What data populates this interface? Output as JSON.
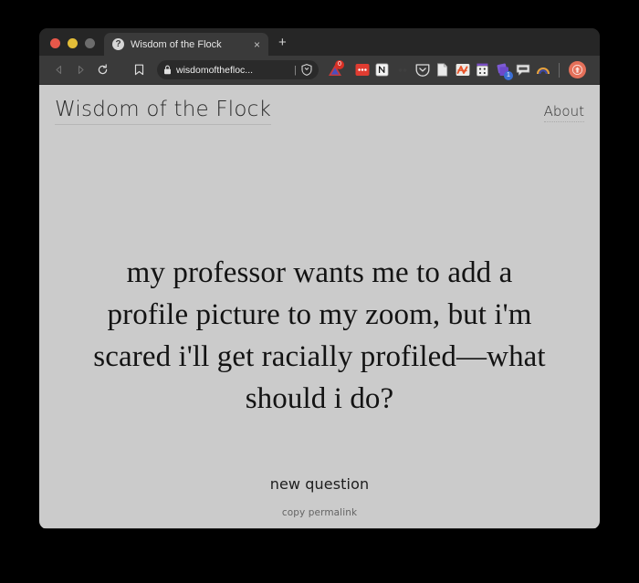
{
  "browser": {
    "traffic_lights": [
      "close",
      "minimize",
      "zoom"
    ],
    "tab": {
      "favicon": "question-mark-favicon",
      "title": "Wisdom of the Flock",
      "close_label": "×"
    },
    "new_tab_label": "+",
    "nav": {
      "back": "back-arrow-icon",
      "forward": "forward-arrow-icon",
      "reload": "reload-icon",
      "bookmark": "bookmark-icon"
    },
    "address_bar": {
      "lock": "lock-icon",
      "url": "wisdomofthefloc...",
      "separator": "|",
      "shield": "brave-shield-icon"
    },
    "extensions": [
      {
        "name": "alert-triangle-extension",
        "badge": "0"
      },
      {
        "name": "red-dots-extension",
        "badge": ""
      },
      {
        "name": "notion-extension",
        "badge": ""
      },
      {
        "name": "small-dots-extension",
        "badge": ""
      },
      {
        "name": "pocket-extension",
        "badge": ""
      },
      {
        "name": "document-extension",
        "badge": ""
      },
      {
        "name": "orange-scribble-extension",
        "badge": ""
      },
      {
        "name": "dice-extension",
        "badge": ""
      },
      {
        "name": "purple-stack-extension",
        "badge": "1"
      },
      {
        "name": "speech-bubble-extension",
        "badge": ""
      },
      {
        "name": "rainbow-extension",
        "badge": ""
      }
    ],
    "profile_avatar": "profile-avatar"
  },
  "page": {
    "site_title": "Wisdom of the Flock",
    "about_label": "About",
    "question": "my professor wants me to add a profile picture to my zoom, but i'm scared i'll get racially profiled—what should i do?",
    "new_question_label": "new question",
    "copy_permalink_label": "copy permalink"
  }
}
